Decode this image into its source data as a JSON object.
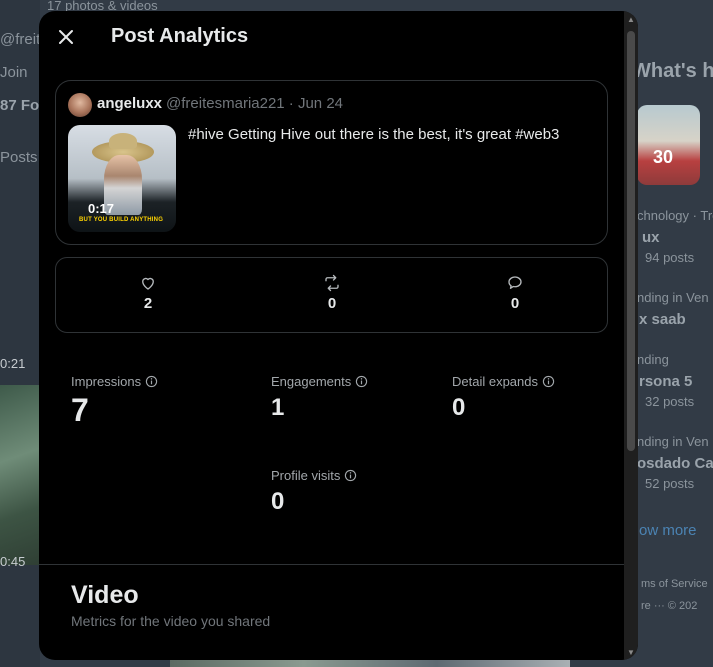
{
  "background": {
    "header_sub": "17 photos & videos",
    "handle_fragment": "@freite",
    "joined_fragment": "Join",
    "followers_fragment": "87 Fol",
    "posts_tab": "Posts",
    "time_top": "0:21",
    "time_bottom": "0:45",
    "sidebar_heading": "What's ha",
    "trend1_meta": "chnology · Tre",
    "trend1_name": "ux",
    "trend1_posts": "94 posts",
    "trend2_meta": "nding in Ven",
    "trend2_name": "x saab",
    "trend3_meta": "nding",
    "trend3_name": "rsona 5",
    "trend3_posts": "32 posts",
    "trend4_meta": "nding in Ven",
    "trend4_name": "osdado Ca",
    "trend4_posts": "52 posts",
    "show_more": "ow more",
    "footer1": "ms of Service",
    "footer2": "re ···   © 202",
    "thumb_number": "30"
  },
  "modal": {
    "title": "Post Analytics",
    "close_icon": "close-icon"
  },
  "post": {
    "author_name": "angeluxx",
    "author_meta": "@freitesmaria221 · Jun 24",
    "text": "#hive Getting Hive out there is the best, it's great #web3",
    "media_duration": "0:17",
    "media_caption": "BUT YOU BUILD ANYTHING"
  },
  "engagement": {
    "likes": "2",
    "reposts": "0",
    "replies": "0"
  },
  "metrics": {
    "impressions_label": "Impressions",
    "impressions_value": "7",
    "engagements_label": "Engagements",
    "engagements_value": "1",
    "detail_expands_label": "Detail expands",
    "detail_expands_value": "0",
    "profile_visits_label": "Profile visits",
    "profile_visits_value": "0"
  },
  "video_section": {
    "title": "Video",
    "subtitle": "Metrics for the video you shared"
  },
  "colors": {
    "modal_bg": "#000000",
    "text_primary": "#e7e9ea",
    "text_secondary": "#71767b",
    "border": "#2f3336"
  }
}
